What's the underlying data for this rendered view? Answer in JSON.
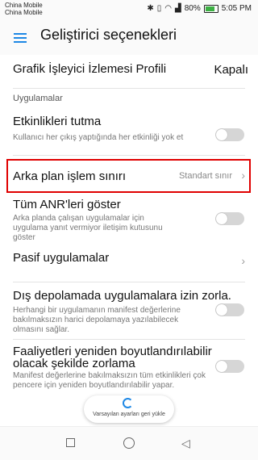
{
  "status_bar": {
    "carrier_1": "China Mobile",
    "carrier_2": "China Mobile",
    "battery": "80%",
    "time": "5:05 PM",
    "icons": [
      "bluetooth-icon",
      "vibrate-icon",
      "wifi-icon",
      "signal-icon",
      "battery-icon"
    ]
  },
  "header": {
    "title": "Geliştirici seçenekleri",
    "menu_icon": "hamburger-menu-icon",
    "accent": "#1e88e5"
  },
  "rows": {
    "gpu_profile": {
      "title": "Grafik İşleyici İzlemesi Profili",
      "value": "Kapalı"
    },
    "section_apps": "Uygulamalar",
    "dont_keep": {
      "title": "Etkinlikleri tutma",
      "subtitle": "Kullanıcı her çıkış yaptığında her etkinliği yok et",
      "enabled": false
    },
    "bg_limit": {
      "title": "Arka plan işlem sınırı",
      "value": "Standart sınır",
      "highlight_color": "#e00000"
    },
    "anr": {
      "title": "Tüm ANR'leri göster",
      "subtitle": "Arka planda çalışan uygulamalar için uygulama yanıt vermiyor iletişim kutusunu göster",
      "enabled": false
    },
    "inactive": {
      "title": "Pasif uygulamalar"
    },
    "external": {
      "title": "Dış depolamada uygulamalara izin zorla.",
      "subtitle": "Herhangi bir uygulamanın manifest değerlerine bakılmaksızın harici depolamaya yazılabilecek olmasını sağlar.",
      "enabled": false
    },
    "resizable": {
      "title": "Faaliyetleri yeniden boyutlandırılabilir olacak şekilde zorlama",
      "subtitle": "Manifest değerlerine bakılmaksızın tüm etkinlikleri çok pencere için yeniden boyutlandırılabilir yapar.",
      "enabled": false
    }
  },
  "reset_button": {
    "label": "Varsayılan ayarları geri yükle"
  },
  "nav_bar": {
    "icons": [
      "recents-icon",
      "home-icon",
      "back-icon"
    ]
  }
}
